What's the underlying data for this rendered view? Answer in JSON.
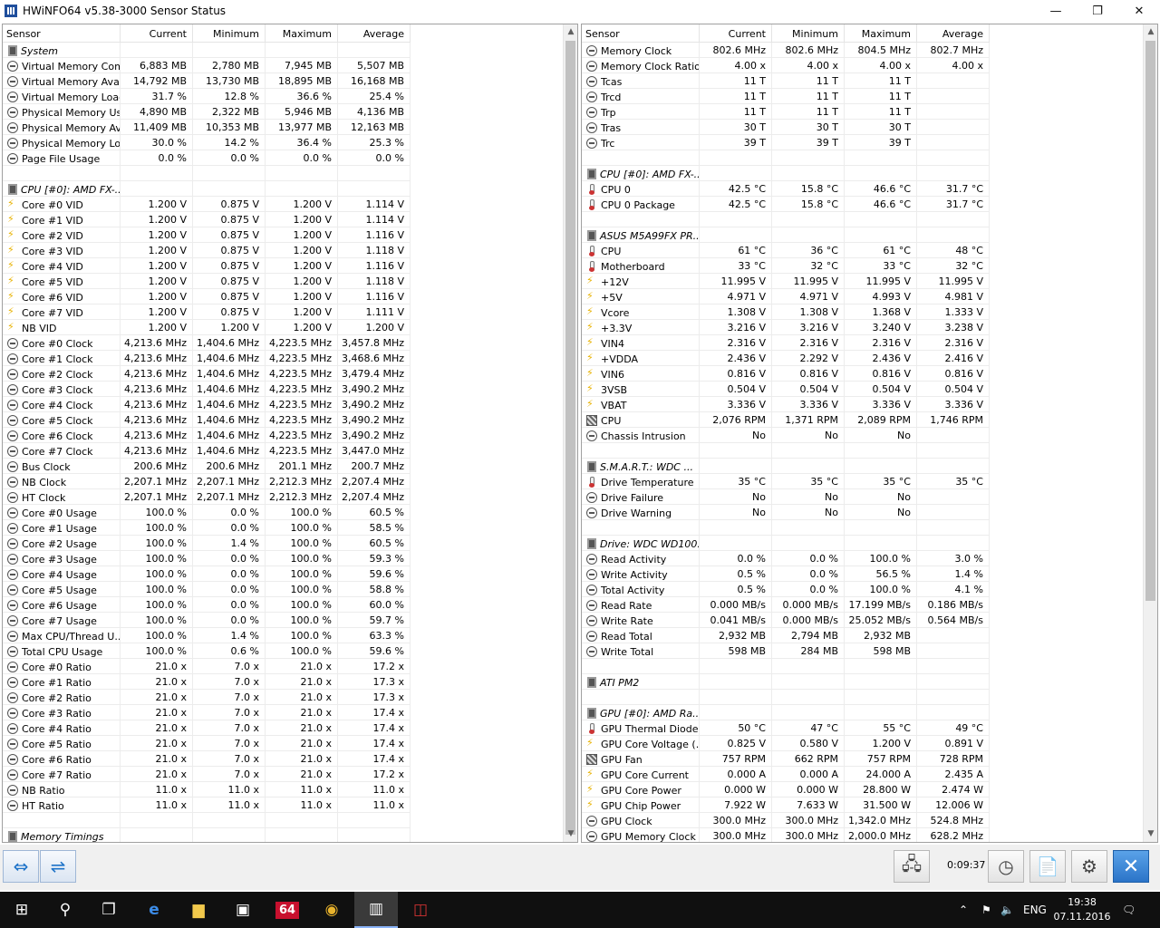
{
  "window": {
    "title": "HWiNFO64 v5.38-3000 Sensor Status",
    "minimize": "—",
    "maximize": "❐",
    "close": "✕"
  },
  "columns": {
    "sensor": "Sensor",
    "current": "Current",
    "minimum": "Minimum",
    "maximum": "Maximum",
    "average": "Average"
  },
  "left_rows": [
    {
      "type": "group",
      "icon": "chip",
      "name": "System"
    },
    {
      "icon": "clock",
      "name": "Virtual Memory Com...",
      "cur": "6,883 MB",
      "min": "2,780 MB",
      "max": "7,945 MB",
      "avg": "5,507 MB"
    },
    {
      "icon": "clock",
      "name": "Virtual Memory Avai...",
      "cur": "14,792 MB",
      "min": "13,730 MB",
      "max": "18,895 MB",
      "avg": "16,168 MB"
    },
    {
      "icon": "clock",
      "name": "Virtual Memory Load",
      "cur": "31.7 %",
      "min": "12.8 %",
      "max": "36.6 %",
      "avg": "25.4 %"
    },
    {
      "icon": "clock",
      "name": "Physical Memory Used",
      "cur": "4,890 MB",
      "min": "2,322 MB",
      "max": "5,946 MB",
      "avg": "4,136 MB"
    },
    {
      "icon": "clock",
      "name": "Physical Memory Av...",
      "cur": "11,409 MB",
      "min": "10,353 MB",
      "max": "13,977 MB",
      "avg": "12,163 MB"
    },
    {
      "icon": "clock",
      "name": "Physical Memory Load",
      "cur": "30.0 %",
      "min": "14.2 %",
      "max": "36.4 %",
      "avg": "25.3 %"
    },
    {
      "icon": "clock",
      "name": "Page File Usage",
      "cur": "0.0 %",
      "min": "0.0 %",
      "max": "0.0 %",
      "avg": "0.0 %"
    },
    {
      "type": "blank"
    },
    {
      "type": "group",
      "icon": "chip",
      "name": "CPU [#0]: AMD FX-..."
    },
    {
      "icon": "volt",
      "name": "Core #0 VID",
      "cur": "1.200 V",
      "min": "0.875 V",
      "max": "1.200 V",
      "avg": "1.114 V"
    },
    {
      "icon": "volt",
      "name": "Core #1 VID",
      "cur": "1.200 V",
      "min": "0.875 V",
      "max": "1.200 V",
      "avg": "1.114 V"
    },
    {
      "icon": "volt",
      "name": "Core #2 VID",
      "cur": "1.200 V",
      "min": "0.875 V",
      "max": "1.200 V",
      "avg": "1.116 V"
    },
    {
      "icon": "volt",
      "name": "Core #3 VID",
      "cur": "1.200 V",
      "min": "0.875 V",
      "max": "1.200 V",
      "avg": "1.118 V"
    },
    {
      "icon": "volt",
      "name": "Core #4 VID",
      "cur": "1.200 V",
      "min": "0.875 V",
      "max": "1.200 V",
      "avg": "1.116 V"
    },
    {
      "icon": "volt",
      "name": "Core #5 VID",
      "cur": "1.200 V",
      "min": "0.875 V",
      "max": "1.200 V",
      "avg": "1.118 V"
    },
    {
      "icon": "volt",
      "name": "Core #6 VID",
      "cur": "1.200 V",
      "min": "0.875 V",
      "max": "1.200 V",
      "avg": "1.116 V"
    },
    {
      "icon": "volt",
      "name": "Core #7 VID",
      "cur": "1.200 V",
      "min": "0.875 V",
      "max": "1.200 V",
      "avg": "1.111 V"
    },
    {
      "icon": "volt",
      "name": "NB VID",
      "cur": "1.200 V",
      "min": "1.200 V",
      "max": "1.200 V",
      "avg": "1.200 V"
    },
    {
      "icon": "clock",
      "name": "Core #0 Clock",
      "cur": "4,213.6 MHz",
      "min": "1,404.6 MHz",
      "max": "4,223.5 MHz",
      "avg": "3,457.8 MHz"
    },
    {
      "icon": "clock",
      "name": "Core #1 Clock",
      "cur": "4,213.6 MHz",
      "min": "1,404.6 MHz",
      "max": "4,223.5 MHz",
      "avg": "3,468.6 MHz"
    },
    {
      "icon": "clock",
      "name": "Core #2 Clock",
      "cur": "4,213.6 MHz",
      "min": "1,404.6 MHz",
      "max": "4,223.5 MHz",
      "avg": "3,479.4 MHz"
    },
    {
      "icon": "clock",
      "name": "Core #3 Clock",
      "cur": "4,213.6 MHz",
      "min": "1,404.6 MHz",
      "max": "4,223.5 MHz",
      "avg": "3,490.2 MHz"
    },
    {
      "icon": "clock",
      "name": "Core #4 Clock",
      "cur": "4,213.6 MHz",
      "min": "1,404.6 MHz",
      "max": "4,223.5 MHz",
      "avg": "3,490.2 MHz"
    },
    {
      "icon": "clock",
      "name": "Core #5 Clock",
      "cur": "4,213.6 MHz",
      "min": "1,404.6 MHz",
      "max": "4,223.5 MHz",
      "avg": "3,490.2 MHz"
    },
    {
      "icon": "clock",
      "name": "Core #6 Clock",
      "cur": "4,213.6 MHz",
      "min": "1,404.6 MHz",
      "max": "4,223.5 MHz",
      "avg": "3,490.2 MHz"
    },
    {
      "icon": "clock",
      "name": "Core #7 Clock",
      "cur": "4,213.6 MHz",
      "min": "1,404.6 MHz",
      "max": "4,223.5 MHz",
      "avg": "3,447.0 MHz"
    },
    {
      "icon": "clock",
      "name": "Bus Clock",
      "cur": "200.6 MHz",
      "min": "200.6 MHz",
      "max": "201.1 MHz",
      "avg": "200.7 MHz"
    },
    {
      "icon": "clock",
      "name": "NB Clock",
      "cur": "2,207.1 MHz",
      "min": "2,207.1 MHz",
      "max": "2,212.3 MHz",
      "avg": "2,207.4 MHz"
    },
    {
      "icon": "clock",
      "name": "HT Clock",
      "cur": "2,207.1 MHz",
      "min": "2,207.1 MHz",
      "max": "2,212.3 MHz",
      "avg": "2,207.4 MHz"
    },
    {
      "icon": "clock",
      "name": "Core #0 Usage",
      "cur": "100.0 %",
      "min": "0.0 %",
      "max": "100.0 %",
      "avg": "60.5 %"
    },
    {
      "icon": "clock",
      "name": "Core #1 Usage",
      "cur": "100.0 %",
      "min": "0.0 %",
      "max": "100.0 %",
      "avg": "58.5 %"
    },
    {
      "icon": "clock",
      "name": "Core #2 Usage",
      "cur": "100.0 %",
      "min": "1.4 %",
      "max": "100.0 %",
      "avg": "60.5 %"
    },
    {
      "icon": "clock",
      "name": "Core #3 Usage",
      "cur": "100.0 %",
      "min": "0.0 %",
      "max": "100.0 %",
      "avg": "59.3 %"
    },
    {
      "icon": "clock",
      "name": "Core #4 Usage",
      "cur": "100.0 %",
      "min": "0.0 %",
      "max": "100.0 %",
      "avg": "59.6 %"
    },
    {
      "icon": "clock",
      "name": "Core #5 Usage",
      "cur": "100.0 %",
      "min": "0.0 %",
      "max": "100.0 %",
      "avg": "58.8 %"
    },
    {
      "icon": "clock",
      "name": "Core #6 Usage",
      "cur": "100.0 %",
      "min": "0.0 %",
      "max": "100.0 %",
      "avg": "60.0 %"
    },
    {
      "icon": "clock",
      "name": "Core #7 Usage",
      "cur": "100.0 %",
      "min": "0.0 %",
      "max": "100.0 %",
      "avg": "59.7 %"
    },
    {
      "icon": "clock",
      "name": "Max CPU/Thread U...",
      "cur": "100.0 %",
      "min": "1.4 %",
      "max": "100.0 %",
      "avg": "63.3 %"
    },
    {
      "icon": "clock",
      "name": "Total CPU Usage",
      "cur": "100.0 %",
      "min": "0.6 %",
      "max": "100.0 %",
      "avg": "59.6 %"
    },
    {
      "icon": "clock",
      "name": "Core #0 Ratio",
      "cur": "21.0 x",
      "min": "7.0 x",
      "max": "21.0 x",
      "avg": "17.2 x"
    },
    {
      "icon": "clock",
      "name": "Core #1 Ratio",
      "cur": "21.0 x",
      "min": "7.0 x",
      "max": "21.0 x",
      "avg": "17.3 x"
    },
    {
      "icon": "clock",
      "name": "Core #2 Ratio",
      "cur": "21.0 x",
      "min": "7.0 x",
      "max": "21.0 x",
      "avg": "17.3 x"
    },
    {
      "icon": "clock",
      "name": "Core #3 Ratio",
      "cur": "21.0 x",
      "min": "7.0 x",
      "max": "21.0 x",
      "avg": "17.4 x"
    },
    {
      "icon": "clock",
      "name": "Core #4 Ratio",
      "cur": "21.0 x",
      "min": "7.0 x",
      "max": "21.0 x",
      "avg": "17.4 x"
    },
    {
      "icon": "clock",
      "name": "Core #5 Ratio",
      "cur": "21.0 x",
      "min": "7.0 x",
      "max": "21.0 x",
      "avg": "17.4 x"
    },
    {
      "icon": "clock",
      "name": "Core #6 Ratio",
      "cur": "21.0 x",
      "min": "7.0 x",
      "max": "21.0 x",
      "avg": "17.4 x"
    },
    {
      "icon": "clock",
      "name": "Core #7 Ratio",
      "cur": "21.0 x",
      "min": "7.0 x",
      "max": "21.0 x",
      "avg": "17.2 x"
    },
    {
      "icon": "clock",
      "name": "NB Ratio",
      "cur": "11.0 x",
      "min": "11.0 x",
      "max": "11.0 x",
      "avg": "11.0 x"
    },
    {
      "icon": "clock",
      "name": "HT Ratio",
      "cur": "11.0 x",
      "min": "11.0 x",
      "max": "11.0 x",
      "avg": "11.0 x"
    },
    {
      "type": "blank"
    },
    {
      "type": "group",
      "icon": "chip",
      "name": "Memory Timings"
    }
  ],
  "right_rows": [
    {
      "icon": "clock",
      "name": "Memory Clock",
      "cur": "802.6 MHz",
      "min": "802.6 MHz",
      "max": "804.5 MHz",
      "avg": "802.7 MHz"
    },
    {
      "icon": "clock",
      "name": "Memory Clock Ratio",
      "cur": "4.00 x",
      "min": "4.00 x",
      "max": "4.00 x",
      "avg": "4.00 x"
    },
    {
      "icon": "clock",
      "name": "Tcas",
      "cur": "11 T",
      "min": "11 T",
      "max": "11 T",
      "avg": ""
    },
    {
      "icon": "clock",
      "name": "Trcd",
      "cur": "11 T",
      "min": "11 T",
      "max": "11 T",
      "avg": ""
    },
    {
      "icon": "clock",
      "name": "Trp",
      "cur": "11 T",
      "min": "11 T",
      "max": "11 T",
      "avg": ""
    },
    {
      "icon": "clock",
      "name": "Tras",
      "cur": "30 T",
      "min": "30 T",
      "max": "30 T",
      "avg": ""
    },
    {
      "icon": "clock",
      "name": "Trc",
      "cur": "39 T",
      "min": "39 T",
      "max": "39 T",
      "avg": ""
    },
    {
      "type": "blank"
    },
    {
      "type": "group",
      "icon": "chip",
      "name": "CPU [#0]: AMD FX-..."
    },
    {
      "icon": "temp",
      "name": "CPU 0",
      "cur": "42.5 °C",
      "min": "15.8 °C",
      "max": "46.6 °C",
      "avg": "31.7 °C"
    },
    {
      "icon": "temp",
      "name": "CPU 0 Package",
      "cur": "42.5 °C",
      "min": "15.8 °C",
      "max": "46.6 °C",
      "avg": "31.7 °C"
    },
    {
      "type": "blank"
    },
    {
      "type": "group",
      "icon": "chip",
      "name": "ASUS M5A99FX PR..."
    },
    {
      "icon": "temp",
      "name": "CPU",
      "cur": "61 °C",
      "min": "36 °C",
      "max": "61 °C",
      "avg": "48 °C"
    },
    {
      "icon": "temp",
      "name": "Motherboard",
      "cur": "33 °C",
      "min": "32 °C",
      "max": "33 °C",
      "avg": "32 °C"
    },
    {
      "icon": "volt",
      "name": "+12V",
      "cur": "11.995 V",
      "min": "11.995 V",
      "max": "11.995 V",
      "avg": "11.995 V"
    },
    {
      "icon": "volt",
      "name": "+5V",
      "cur": "4.971 V",
      "min": "4.971 V",
      "max": "4.993 V",
      "avg": "4.981 V"
    },
    {
      "icon": "volt",
      "name": "Vcore",
      "cur": "1.308 V",
      "min": "1.308 V",
      "max": "1.368 V",
      "avg": "1.333 V"
    },
    {
      "icon": "volt",
      "name": "+3.3V",
      "cur": "3.216 V",
      "min": "3.216 V",
      "max": "3.240 V",
      "avg": "3.238 V"
    },
    {
      "icon": "volt",
      "name": "VIN4",
      "cur": "2.316 V",
      "min": "2.316 V",
      "max": "2.316 V",
      "avg": "2.316 V"
    },
    {
      "icon": "volt",
      "name": "+VDDA",
      "cur": "2.436 V",
      "min": "2.292 V",
      "max": "2.436 V",
      "avg": "2.416 V"
    },
    {
      "icon": "volt",
      "name": "VIN6",
      "cur": "0.816 V",
      "min": "0.816 V",
      "max": "0.816 V",
      "avg": "0.816 V"
    },
    {
      "icon": "volt",
      "name": "3VSB",
      "cur": "0.504 V",
      "min": "0.504 V",
      "max": "0.504 V",
      "avg": "0.504 V"
    },
    {
      "icon": "volt",
      "name": "VBAT",
      "cur": "3.336 V",
      "min": "3.336 V",
      "max": "3.336 V",
      "avg": "3.336 V"
    },
    {
      "icon": "fan",
      "name": "CPU",
      "cur": "2,076 RPM",
      "min": "1,371 RPM",
      "max": "2,089 RPM",
      "avg": "1,746 RPM"
    },
    {
      "icon": "clock",
      "name": "Chassis Intrusion",
      "cur": "No",
      "min": "No",
      "max": "No",
      "avg": ""
    },
    {
      "type": "blank"
    },
    {
      "type": "group",
      "icon": "chip",
      "name": "S.M.A.R.T.: WDC ..."
    },
    {
      "icon": "temp",
      "name": "Drive Temperature",
      "cur": "35 °C",
      "min": "35 °C",
      "max": "35 °C",
      "avg": "35 °C"
    },
    {
      "icon": "clock",
      "name": "Drive Failure",
      "cur": "No",
      "min": "No",
      "max": "No",
      "avg": ""
    },
    {
      "icon": "clock",
      "name": "Drive Warning",
      "cur": "No",
      "min": "No",
      "max": "No",
      "avg": ""
    },
    {
      "type": "blank"
    },
    {
      "type": "group",
      "icon": "chip",
      "name": "Drive: WDC WD100..."
    },
    {
      "icon": "clock",
      "name": "Read Activity",
      "cur": "0.0 %",
      "min": "0.0 %",
      "max": "100.0 %",
      "avg": "3.0 %"
    },
    {
      "icon": "clock",
      "name": "Write Activity",
      "cur": "0.5 %",
      "min": "0.0 %",
      "max": "56.5 %",
      "avg": "1.4 %"
    },
    {
      "icon": "clock",
      "name": "Total Activity",
      "cur": "0.5 %",
      "min": "0.0 %",
      "max": "100.0 %",
      "avg": "4.1 %"
    },
    {
      "icon": "clock",
      "name": "Read Rate",
      "cur": "0.000 MB/s",
      "min": "0.000 MB/s",
      "max": "17.199 MB/s",
      "avg": "0.186 MB/s"
    },
    {
      "icon": "clock",
      "name": "Write Rate",
      "cur": "0.041 MB/s",
      "min": "0.000 MB/s",
      "max": "25.052 MB/s",
      "avg": "0.564 MB/s"
    },
    {
      "icon": "clock",
      "name": "Read Total",
      "cur": "2,932 MB",
      "min": "2,794 MB",
      "max": "2,932 MB",
      "avg": ""
    },
    {
      "icon": "clock",
      "name": "Write Total",
      "cur": "598 MB",
      "min": "284 MB",
      "max": "598 MB",
      "avg": ""
    },
    {
      "type": "blank"
    },
    {
      "type": "group",
      "icon": "chip",
      "name": "ATI PM2"
    },
    {
      "type": "blank"
    },
    {
      "type": "group",
      "icon": "chip",
      "name": "GPU [#0]: AMD Ra..."
    },
    {
      "icon": "temp",
      "name": "GPU Thermal Diode",
      "cur": "50 °C",
      "min": "47 °C",
      "max": "55 °C",
      "avg": "49 °C"
    },
    {
      "icon": "volt",
      "name": "GPU Core Voltage (...",
      "cur": "0.825 V",
      "min": "0.580 V",
      "max": "1.200 V",
      "avg": "0.891 V"
    },
    {
      "icon": "fan",
      "name": "GPU Fan",
      "cur": "757 RPM",
      "min": "662 RPM",
      "max": "757 RPM",
      "avg": "728 RPM"
    },
    {
      "icon": "volt",
      "name": "GPU Core Current",
      "cur": "0.000 A",
      "min": "0.000 A",
      "max": "24.000 A",
      "avg": "2.435 A"
    },
    {
      "icon": "volt",
      "name": "GPU Core Power",
      "cur": "0.000 W",
      "min": "0.000 W",
      "max": "28.800 W",
      "avg": "2.474 W"
    },
    {
      "icon": "volt",
      "name": "GPU Chip Power",
      "cur": "7.922 W",
      "min": "7.633 W",
      "max": "31.500 W",
      "avg": "12.006 W"
    },
    {
      "icon": "clock",
      "name": "GPU Clock",
      "cur": "300.0 MHz",
      "min": "300.0 MHz",
      "max": "1,342.0 MHz",
      "avg": "524.8 MHz"
    },
    {
      "icon": "clock",
      "name": "GPU Memory Clock",
      "cur": "300.0 MHz",
      "min": "300.0 MHz",
      "max": "2,000.0 MHz",
      "avg": "628.2 MHz"
    }
  ],
  "toolbar": {
    "timer": "0:09:37"
  },
  "taskbar": {
    "language": "ENG",
    "time": "19:38",
    "date": "07.11.2016",
    "hwinfo_badge": "64"
  }
}
